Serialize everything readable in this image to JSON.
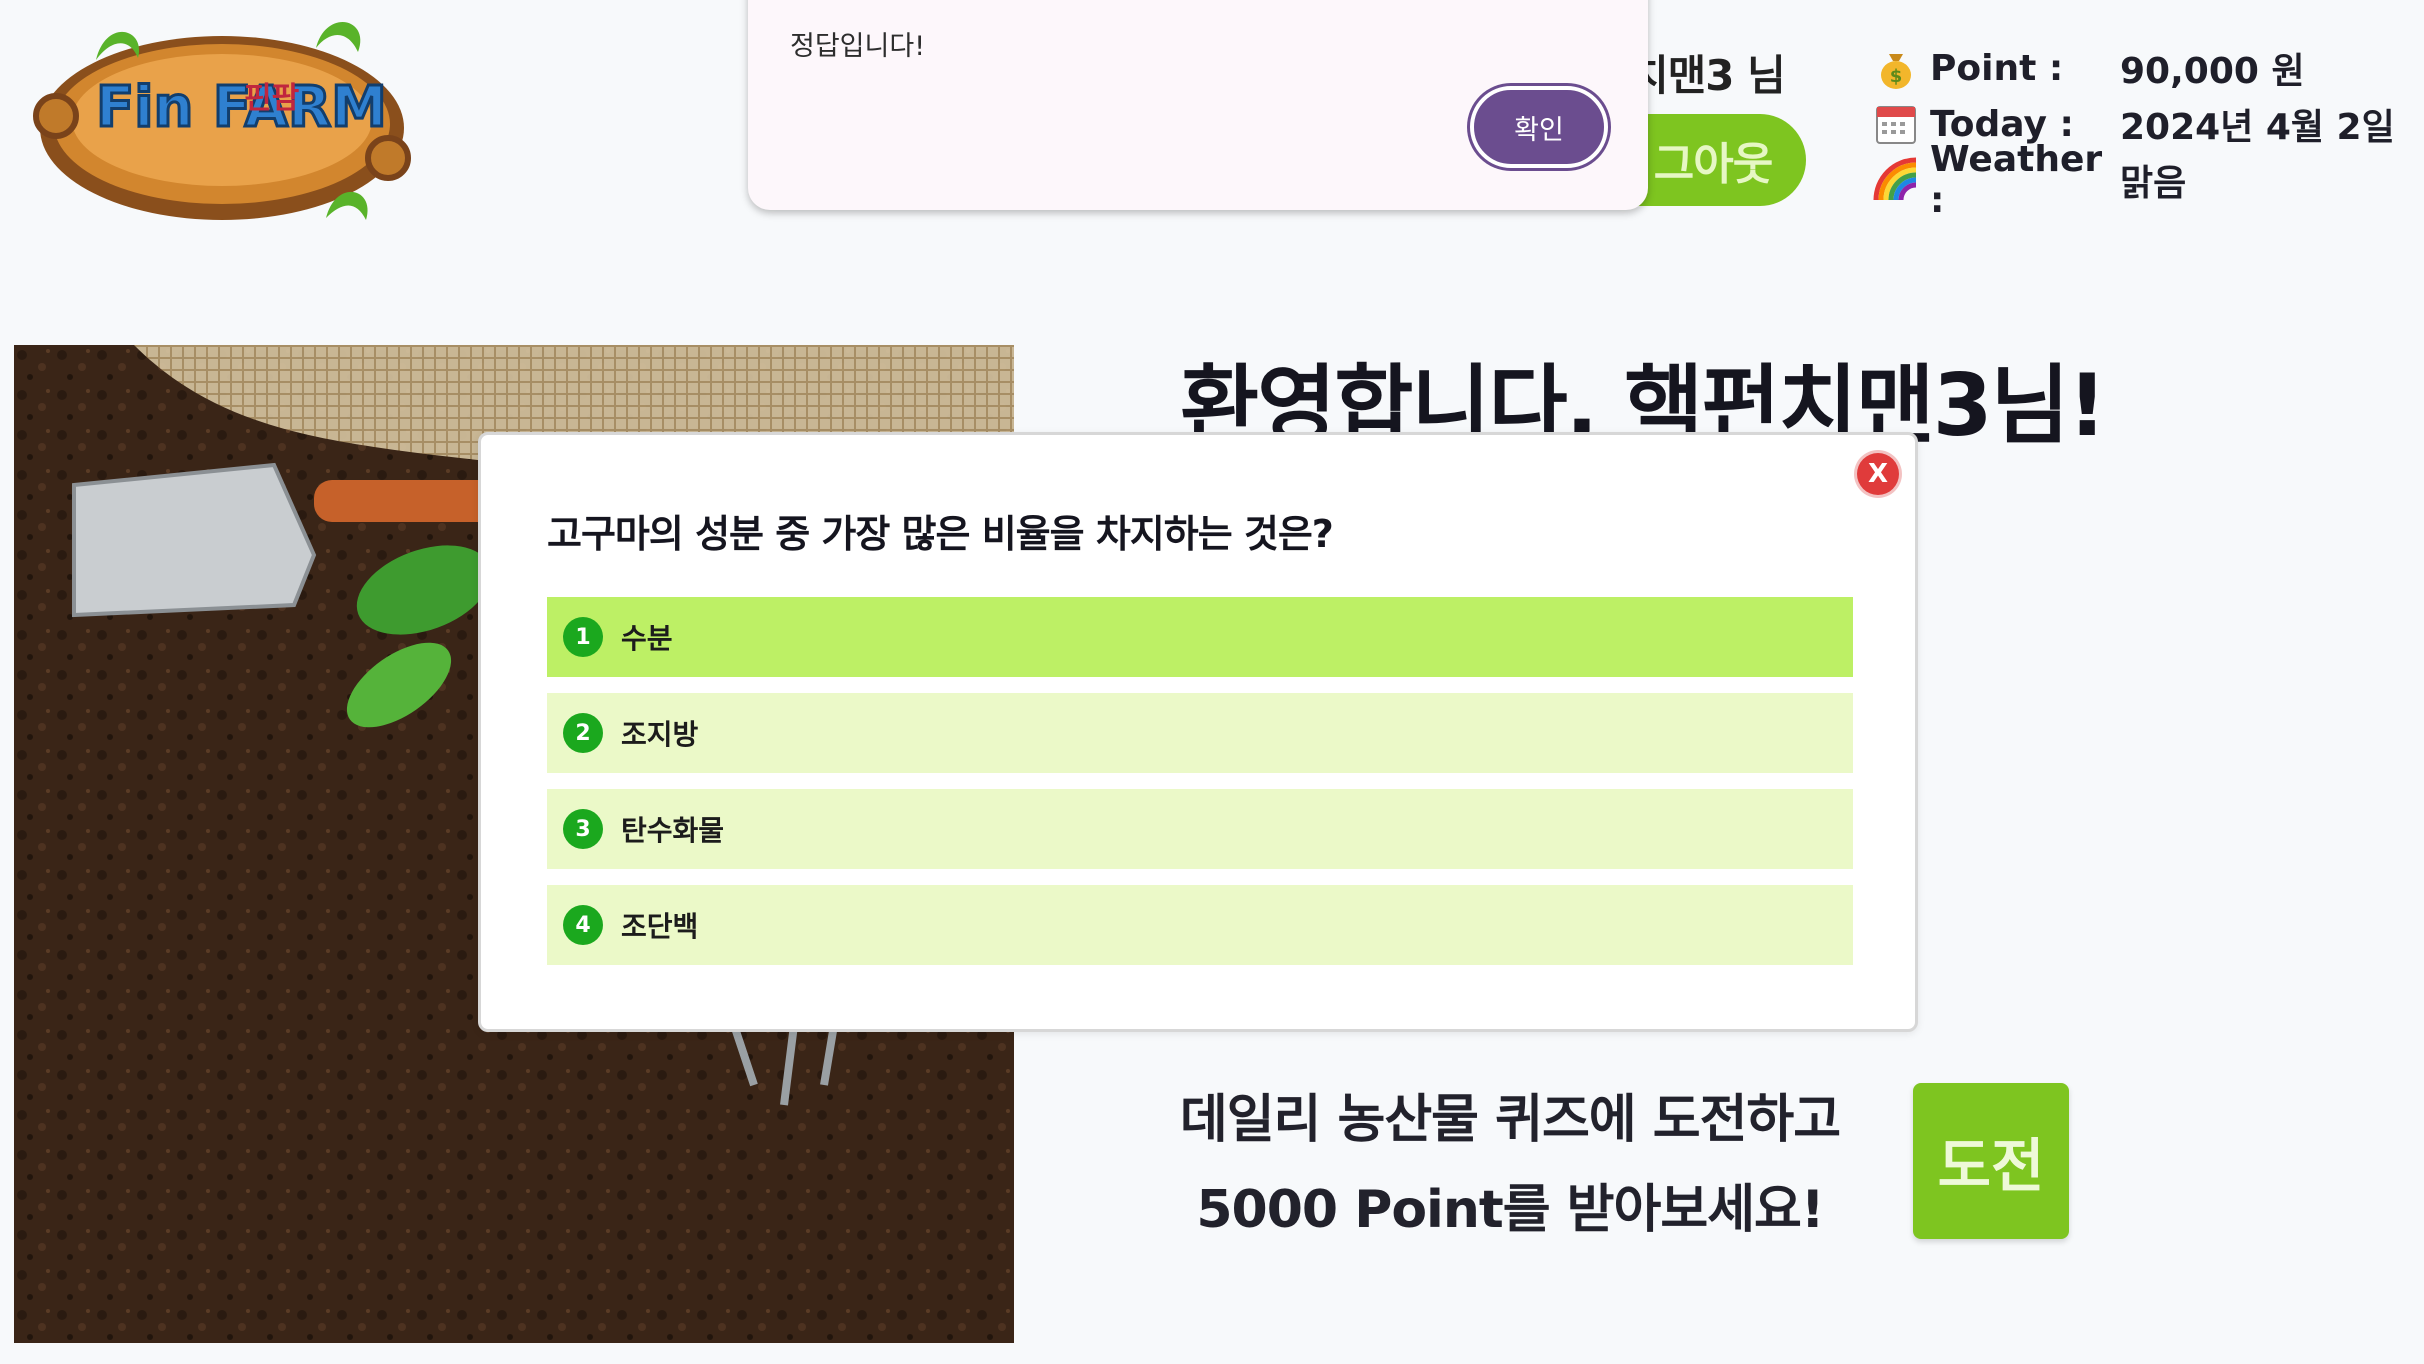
{
  "logo": {
    "text_en": "Fin FARM",
    "text_ko": "핀팜"
  },
  "header": {
    "user_name": "치맨3 님",
    "logout_label": "그아웃",
    "point_label": "Point :",
    "point_value": "90,000 원",
    "today_label": "Today :",
    "today_value": "2024년 4월 2일",
    "weather_label": "Weather :",
    "weather_value": "맑음"
  },
  "main": {
    "welcome": "환영합니다, 핵펀치맨3님!",
    "cta_line1": "데일리 농산물 퀴즈에 도전하고",
    "cta_line2": "5000 Point를 받아보세요!",
    "challenge_label": "도전"
  },
  "quiz": {
    "close_label": "X",
    "question": "고구마의 성분 중 가장 많은 비율을 차지하는 것은?",
    "options": [
      {
        "num": "1",
        "label": "수분"
      },
      {
        "num": "2",
        "label": "조지방"
      },
      {
        "num": "3",
        "label": "탄수화물"
      },
      {
        "num": "4",
        "label": "조단백"
      }
    ],
    "selected_option": "1"
  },
  "alert": {
    "message": "정답입니다!",
    "ok_label": "확인"
  },
  "colors": {
    "brand_green": "#7ec520",
    "option_selected": "#bdf065",
    "option_bg": "#ebf9c8",
    "alert_button": "#6b4d8f",
    "close_red": "#e03b3b"
  },
  "icons": {
    "point": "money-bag-icon",
    "today": "calendar-icon",
    "weather": "rainbow-icon"
  }
}
